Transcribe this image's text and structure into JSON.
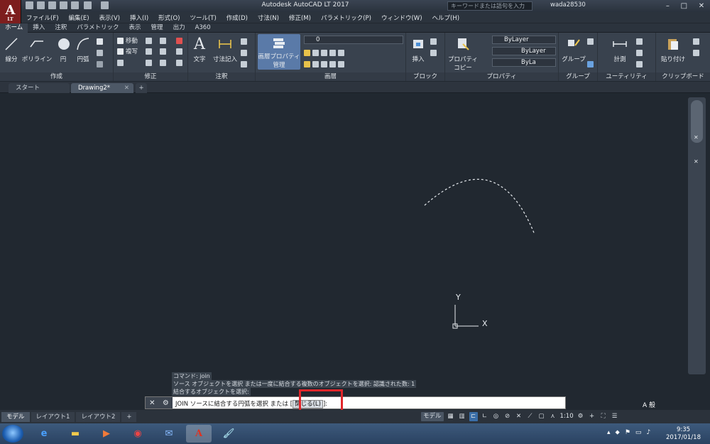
{
  "app": {
    "title": "Autodesk AutoCAD LT 2017",
    "logo_letter": "A",
    "logo_sub": "LT",
    "search_placeholder": "キーワードまたは語句を入力",
    "user": "wada28530"
  },
  "menu": [
    "ファイル(F)",
    "編集(E)",
    "表示(V)",
    "挿入(I)",
    "形式(O)",
    "ツール(T)",
    "作成(D)",
    "寸法(N)",
    "修正(M)",
    "パラメトリック(P)",
    "ウィンドウ(W)",
    "ヘルプ(H)"
  ],
  "ribbon_tabs": [
    "ホーム",
    "挿入",
    "注釈",
    "パラメトリック",
    "表示",
    "管理",
    "出力",
    "A360"
  ],
  "ribbon": {
    "create": {
      "title": "作成",
      "line": "線分",
      "polyline": "ポリライン",
      "circle": "円",
      "arc": "円弧"
    },
    "modify": {
      "title": "修正",
      "move": "移動",
      "copy": "複写"
    },
    "annotation": {
      "title": "注釈",
      "text": "文字",
      "dimension": "寸法記入"
    },
    "layers": {
      "title": "画層",
      "properties": "画層プロパティ",
      "manage": "管理",
      "current_layer": "0"
    },
    "block": {
      "title": "ブロック",
      "insert": "挿入"
    },
    "properties": {
      "title": "プロパティ",
      "copy_prop": "プロパティ",
      "copy_prop2": "コピー",
      "color": "ByLayer",
      "linetype": "ByLayer",
      "lineweight": "ByLa"
    },
    "groups": {
      "title": "グループ",
      "group": "グループ"
    },
    "utilities": {
      "title": "ユーティリティ",
      "measure": "計測"
    },
    "clipboard": {
      "title": "クリップボード",
      "paste": "貼り付け"
    }
  },
  "doc_tabs": {
    "start": "スタート",
    "drawing": "Drawing2*",
    "add": "+"
  },
  "axis": {
    "x": "X",
    "y": "Y"
  },
  "command": {
    "history": [
      "コマンド: join",
      "ソース オブジェクトを選択 または一度に結合する複数のオブジェクトを選択: 認識された数: 1",
      "結合するオブジェクトを選択:"
    ],
    "prompt": "JOIN ソースに結合する円弧を選択 または [",
    "option": "閉じる(L)",
    "prompt_end": "]:"
  },
  "layout_tabs": [
    "モデル",
    "レイアウト1",
    "レイアウト2",
    "+"
  ],
  "status": {
    "model": "モデル",
    "scale": "1:10"
  },
  "tray": {
    "ime": "A 般"
  },
  "clock": {
    "time": "9:35",
    "date": "2017/01/18"
  }
}
